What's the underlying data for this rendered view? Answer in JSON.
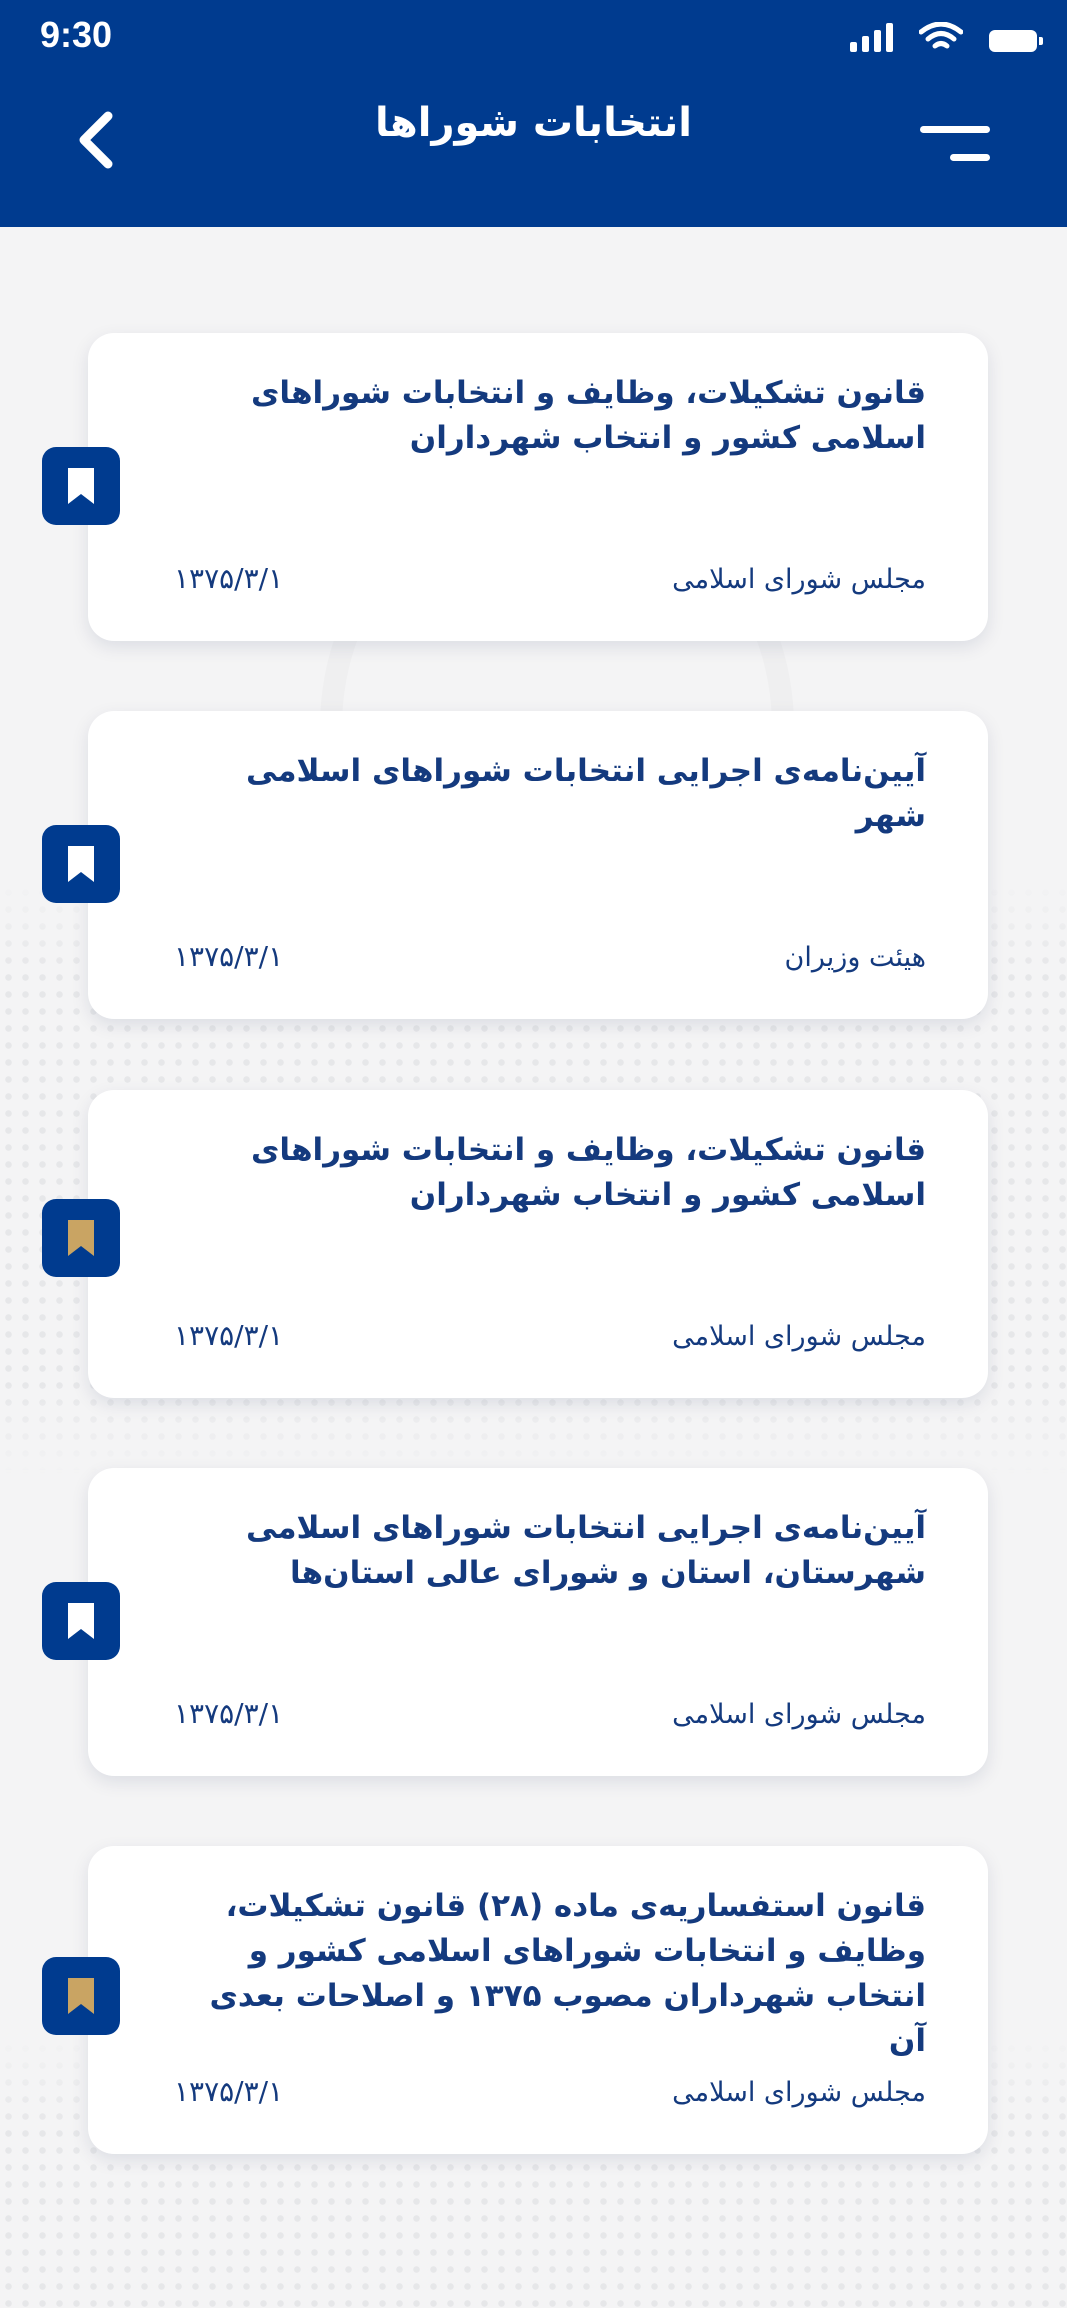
{
  "status_bar": {
    "time": "9:30"
  },
  "header": {
    "title": "انتخابات شوراها"
  },
  "colors": {
    "primary": "#003b8f",
    "bookmark_saved": "#c9a463",
    "bookmark_unsaved": "#ffffff"
  },
  "cards": [
    {
      "title": "قانون تشکیلات، وظایف و انتخابات شوراهای اسلامی کشور و انتخاب شهرداران",
      "source": "مجلس شورای اسلامی",
      "date": "۱۳۷۵/۳/۱",
      "bookmark_icon": "bookmark-icon",
      "bookmarked": false
    },
    {
      "title": "آیین‌نامه‌ی اجرایی انتخابات شوراهای اسلامی شهر",
      "source": "هیئت وزیران",
      "date": "۱۳۷۵/۳/۱",
      "bookmark_icon": "bookmark-icon",
      "bookmarked": false
    },
    {
      "title": "قانون تشکیلات، وظایف و انتخابات شوراهای اسلامی کشور و انتخاب شهرداران",
      "source": "مجلس شورای اسلامی",
      "date": "۱۳۷۵/۳/۱",
      "bookmark_icon": "bookmark-icon",
      "bookmarked": true
    },
    {
      "title": "آیین‌نامه‌ی اجرایی انتخابات شوراهای اسلامی شهرستان، استان و شورای عالی استان‌ها",
      "source": "مجلس شورای اسلامی",
      "date": "۱۳۷۵/۳/۱",
      "bookmark_icon": "bookmark-icon",
      "bookmarked": false
    },
    {
      "title": "قانون استفساریه‌ی ماده (۲۸) قانون تشکیلات، وظایف و انتخابات شوراهای اسلامی کشور و انتخاب شهرداران مصوب ۱۳۷۵ و اصلاحات بعدی آن",
      "source": "مجلس شورای اسلامی",
      "date": "۱۳۷۵/۳/۱",
      "bookmark_icon": "bookmark-icon",
      "bookmarked": true
    }
  ]
}
